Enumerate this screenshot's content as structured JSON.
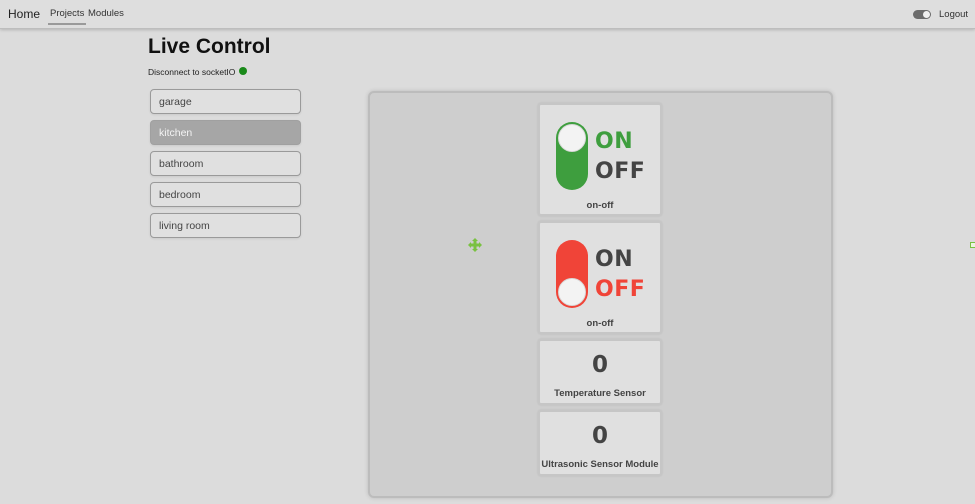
{
  "navbar": {
    "brand": "Home",
    "links": [
      {
        "label": "Projects",
        "active": true
      },
      {
        "label": "Modules",
        "active": false
      }
    ],
    "theme_toggle_on": true,
    "logout_label": "Logout"
  },
  "page": {
    "title": "Live Control",
    "socket_status": "Disconnect to socketIO",
    "socket_status_color": "#1a8a1a"
  },
  "rooms": [
    {
      "label": "garage",
      "selected": false
    },
    {
      "label": "kitchen",
      "selected": true
    },
    {
      "label": "bathroom",
      "selected": false
    },
    {
      "label": "bedroom",
      "selected": false
    },
    {
      "label": "living room",
      "selected": false
    }
  ],
  "modules": [
    {
      "type": "switch",
      "state": "on",
      "on_text": "ON",
      "off_text": "OFF",
      "label": "on-off",
      "accent": "#3e9e3e"
    },
    {
      "type": "switch",
      "state": "off",
      "on_text": "ON",
      "off_text": "OFF",
      "label": "on-off",
      "accent": "#f04438"
    },
    {
      "type": "sensor",
      "value": "0",
      "label": "Temperature Sensor"
    },
    {
      "type": "sensor",
      "value": "0",
      "label": "Ultrasonic Sensor Module"
    }
  ],
  "icons": {
    "move_handle": "move-arrows-icon",
    "handle_color": "#7ac142"
  }
}
